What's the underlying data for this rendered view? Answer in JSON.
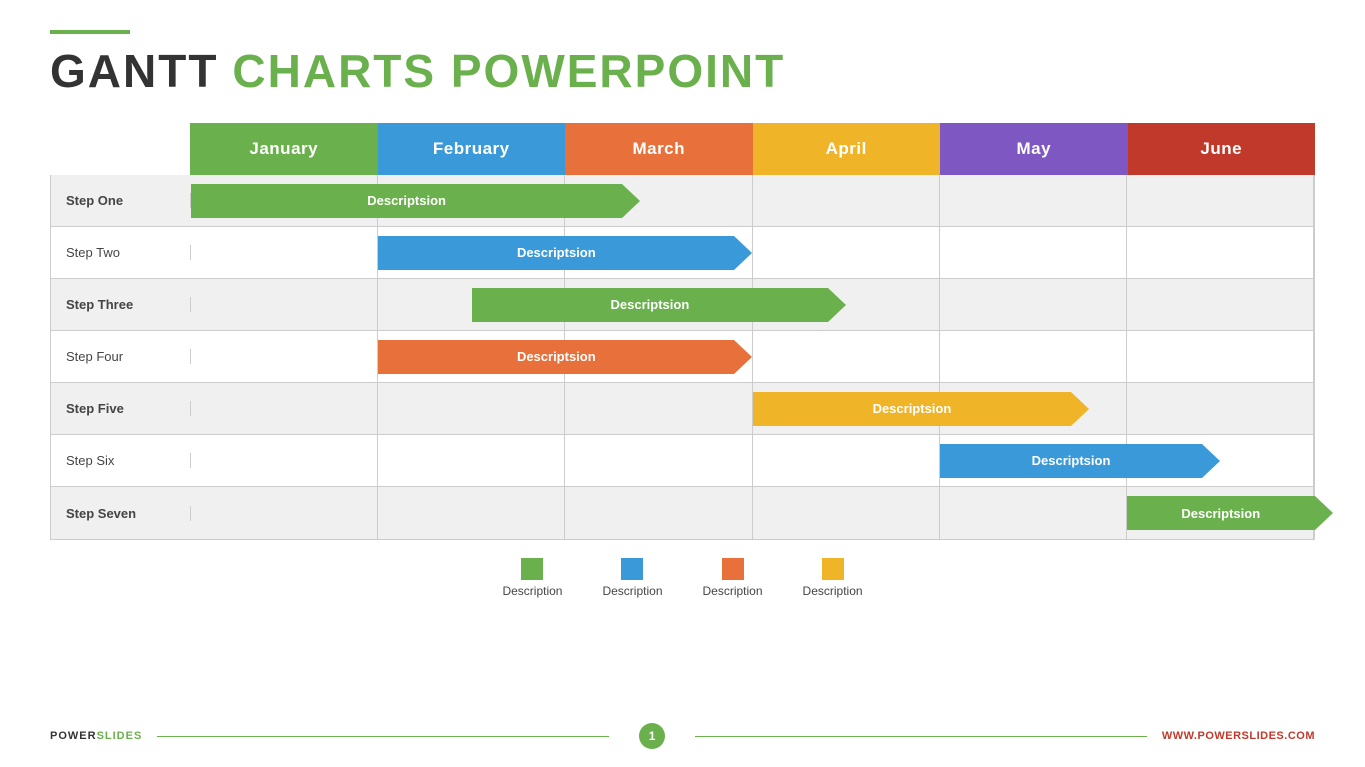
{
  "title": {
    "accent_line": true,
    "part1": "GANTT",
    "part2": "CHARTS POWERPOINT"
  },
  "months": [
    {
      "label": "January",
      "color": "#6ab04c",
      "id": "jan"
    },
    {
      "label": "February",
      "color": "#3a9ad9",
      "id": "feb"
    },
    {
      "label": "March",
      "color": "#e8703a",
      "id": "mar"
    },
    {
      "label": "April",
      "color": "#f0b429",
      "id": "apr"
    },
    {
      "label": "May",
      "color": "#7e57c2",
      "id": "may"
    },
    {
      "label": "June",
      "color": "#c0392b",
      "id": "jun"
    }
  ],
  "rows": [
    {
      "label": "Step One",
      "shaded": true,
      "bold": true,
      "bar": {
        "color": "#6ab04c",
        "text": "Descriptsion",
        "start": 0,
        "width": 2.4
      }
    },
    {
      "label": "Step Two",
      "shaded": false,
      "bold": false,
      "bar": {
        "color": "#3a9ad9",
        "text": "Descriptsion",
        "start": 1,
        "width": 2.0
      }
    },
    {
      "label": "Step Three",
      "shaded": true,
      "bold": true,
      "bar": {
        "color": "#6ab04c",
        "text": "Descriptsion",
        "start": 1.5,
        "width": 2.0
      }
    },
    {
      "label": "Step Four",
      "shaded": false,
      "bold": false,
      "bar": {
        "color": "#e8703a",
        "text": "Descriptsion",
        "start": 1,
        "width": 2.0
      }
    },
    {
      "label": "Step Five",
      "shaded": true,
      "bold": true,
      "bar": {
        "color": "#f0b429",
        "text": "Descriptsion",
        "start": 3,
        "width": 1.8
      }
    },
    {
      "label": "Step Six",
      "shaded": false,
      "bold": false,
      "bar": {
        "color": "#3a9ad9",
        "text": "Descriptsion",
        "start": 4,
        "width": 1.5
      }
    },
    {
      "label": "Step Seven",
      "shaded": true,
      "bold": true,
      "bar": {
        "color": "#6ab04c",
        "text": "Descriptsion",
        "start": 5,
        "width": 1.1
      }
    }
  ],
  "legend": [
    {
      "color": "#6ab04c",
      "label": "Description"
    },
    {
      "color": "#3a9ad9",
      "label": "Description"
    },
    {
      "color": "#e8703a",
      "label": "Description"
    },
    {
      "color": "#f0b429",
      "label": "Description"
    }
  ],
  "footer": {
    "left_power": "POWER",
    "left_slides": "SLIDES",
    "page": "1",
    "right": "WWW.POWERSLIDES.COM"
  }
}
